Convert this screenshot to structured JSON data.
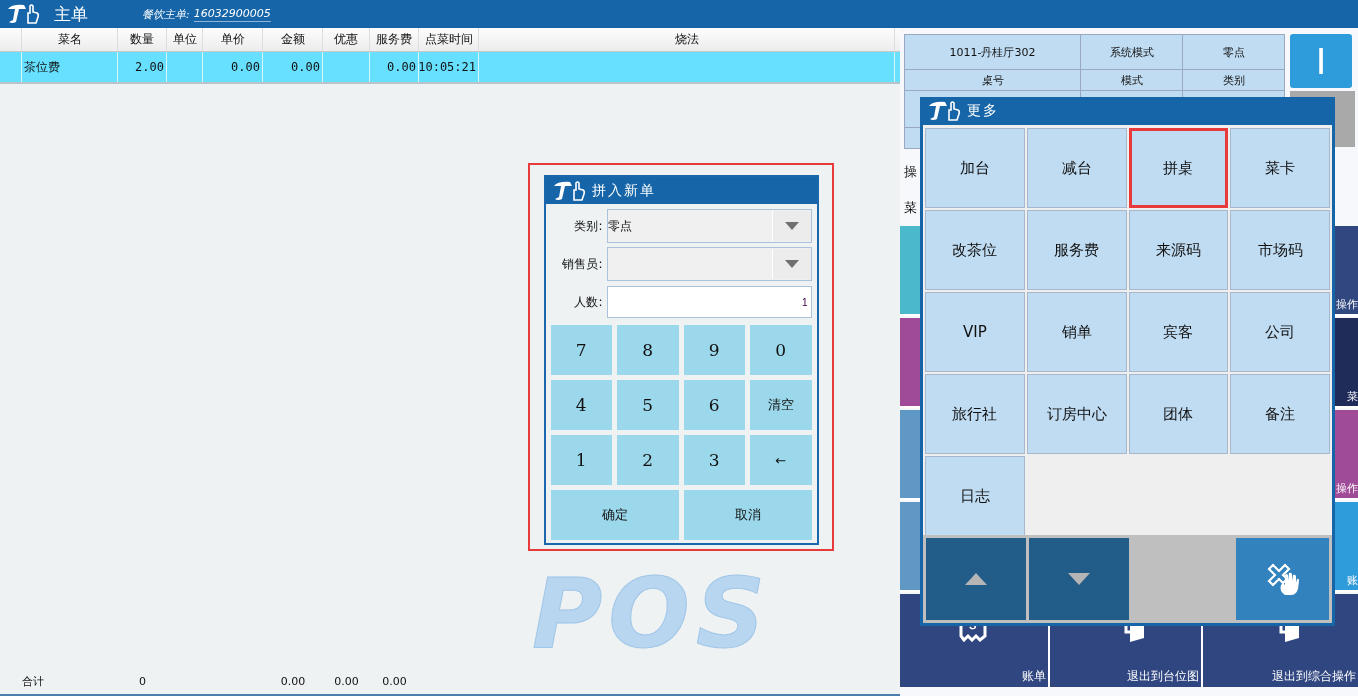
{
  "header": {
    "title": "主单",
    "order_label": "餐饮主单:",
    "order_no": "16032900005"
  },
  "table": {
    "columns": [
      "菜名",
      "数量",
      "单位",
      "单价",
      "金额",
      "优惠",
      "服务费",
      "点菜时间",
      "烧法"
    ],
    "rows": [
      {
        "selected": true,
        "cells": [
          "茶位费",
          "2.00",
          null,
          "0.00",
          "0.00",
          null,
          "0.00",
          "10:05:21",
          null
        ]
      }
    ]
  },
  "totals": {
    "label": "合计",
    "cells": [
      "0",
      null,
      null,
      "0.00",
      "0.00",
      "0.00"
    ]
  },
  "background_logo": "POS",
  "join_dialog": {
    "title": "拼入新单",
    "highlighted": true,
    "fields": [
      {
        "kind": "select",
        "label": "类别:",
        "value": "零点"
      },
      {
        "kind": "select",
        "label": "销售员:"
      },
      {
        "kind": "input",
        "label": "人数:",
        "value": "1"
      }
    ],
    "keys": [
      {
        "label": "7",
        "kind": "digit"
      },
      {
        "label": "8",
        "kind": "digit"
      },
      {
        "label": "9",
        "kind": "digit"
      },
      {
        "label": "0",
        "kind": "digit"
      },
      {
        "label": "4",
        "kind": "digit"
      },
      {
        "label": "5",
        "kind": "digit"
      },
      {
        "label": "6",
        "kind": "digit"
      },
      {
        "label": "清空",
        "kind": "action"
      },
      {
        "label": "1",
        "kind": "digit"
      },
      {
        "label": "2",
        "kind": "digit"
      },
      {
        "label": "3",
        "kind": "digit"
      },
      {
        "label": "←",
        "kind": "action"
      },
      {
        "label": "确定",
        "kind": "wide"
      },
      {
        "label": "取消",
        "kind": "wide"
      }
    ]
  },
  "info": {
    "cells": [
      {
        "value": "1011-丹桂厅302",
        "label": "桌号"
      },
      {
        "value": "系统模式",
        "label": "模式"
      },
      {
        "value": "零点",
        "label": "类别"
      }
    ],
    "big_button": "I"
  },
  "side_labels": [
    "操",
    "菜"
  ],
  "tile_rows": [
    {
      "tiles": [
        {
          "color": "#4cb8cc"
        },
        {
          "color": "#30477f",
          "label": "操作"
        }
      ]
    },
    {
      "tiles": [
        {
          "color": "#a04b98"
        },
        {
          "color": "#1f2c5a",
          "label": "菜"
        }
      ]
    },
    {
      "tiles": [
        {
          "color": "#5f97c5"
        },
        {
          "color": "#a04b98",
          "label": "操作"
        }
      ]
    },
    {
      "tiles": [
        {
          "color": "#5f97c5"
        },
        {
          "color": "#2e9bda",
          "label": "账"
        }
      ]
    }
  ],
  "bottom_actions": [
    {
      "label": "账单",
      "kind": "receipt"
    },
    {
      "label": "退出到台位图",
      "kind": "exit"
    },
    {
      "label": "退出到综合操作",
      "kind": "exit"
    }
  ],
  "more_dialog": {
    "title": "更多",
    "items": [
      {
        "label": "加台",
        "selected": false
      },
      {
        "label": "减台",
        "selected": false
      },
      {
        "label": "拼桌",
        "selected": true
      },
      {
        "label": "菜卡",
        "selected": false
      },
      {
        "label": "改茶位",
        "selected": false
      },
      {
        "label": "服务费",
        "selected": false
      },
      {
        "label": "来源码",
        "selected": false
      },
      {
        "label": "市场码",
        "selected": false
      },
      {
        "label": "VIP",
        "selected": false
      },
      {
        "label": "销单",
        "selected": false
      },
      {
        "label": "宾客",
        "selected": false
      },
      {
        "label": "公司",
        "selected": false
      },
      {
        "label": "旅行社",
        "selected": false
      },
      {
        "label": "订房中心",
        "selected": false
      },
      {
        "label": "团体",
        "selected": false
      },
      {
        "label": "备注",
        "selected": false
      },
      {
        "label": "日志",
        "selected": false
      }
    ],
    "nav": [
      {
        "kind": "up"
      },
      {
        "kind": "down"
      },
      {
        "kind": "blank"
      },
      {
        "kind": "close"
      }
    ]
  }
}
